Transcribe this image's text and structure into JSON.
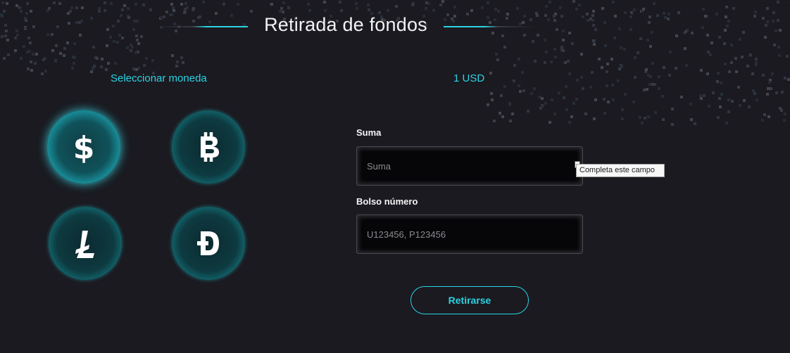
{
  "colors": {
    "background": "#1a1a20",
    "accent": "#2bd3e4",
    "input_bg": "#060608"
  },
  "header": {
    "title": "Retirada de fondos"
  },
  "currency_panel": {
    "label": "Seleccionar moneda",
    "coins": [
      {
        "name": "dollar",
        "icon": "dollar-icon",
        "glyph": "$",
        "selected": true
      },
      {
        "name": "bitcoin",
        "icon": "bitcoin-icon",
        "glyph": "₿",
        "selected": false
      },
      {
        "name": "litecoin",
        "icon": "litecoin-icon",
        "glyph": "Ł",
        "selected": false
      },
      {
        "name": "dogecoin",
        "icon": "dogecoin-icon",
        "glyph": "Ð",
        "selected": false
      }
    ]
  },
  "form": {
    "rate_label": "1 USD",
    "amount": {
      "label": "Suma",
      "placeholder": "Suma",
      "value": ""
    },
    "wallet": {
      "label": "Bolso número",
      "placeholder": "U123456, P123456",
      "value": ""
    },
    "validation_tooltip": "Completa este campo",
    "submit_label": "Retirarse"
  }
}
